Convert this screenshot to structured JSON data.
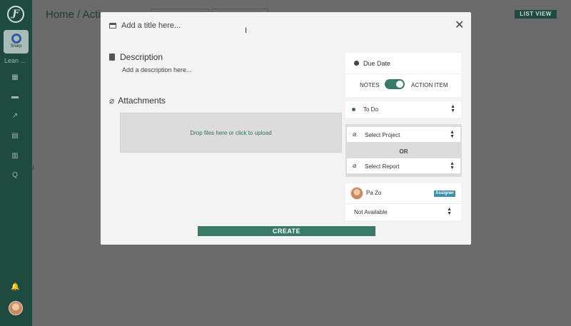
{
  "sidebar": {
    "logo_glyph": "Ƒ",
    "workspace_card_label": "Sharp",
    "workspace_name": "Lean ...",
    "nav_icons": [
      "dashboard-icon",
      "folder-icon",
      "chart-icon",
      "board-icon",
      "book-icon",
      "q-icon"
    ],
    "nav_glyphs": [
      "▦",
      "▬",
      "↗",
      "▤",
      "▥",
      "Q"
    ],
    "bell_glyph": "🔔"
  },
  "header": {
    "title": "Home / Actio",
    "list_view_label": "LIST VIEW"
  },
  "modal": {
    "title_placeholder": "Add a title here...",
    "close_glyph": "✕",
    "cursor_glyph": "I",
    "description_heading": "Description",
    "description_placeholder": "Add a description here...",
    "attachments_heading": "Attachments",
    "attachment_glyph": "⌀",
    "dropzone_text": "Drop files here or click to upload",
    "due_date_label": "Due Date",
    "toggle_left_label": "NOTES",
    "toggle_right_label": "ACTION ITEM",
    "status_value": "To Do",
    "select_project_label": "Select Project",
    "or_label": "OR",
    "select_report_label": "Select Report",
    "assignee_name": "Pa Zo",
    "assignee_badge": "Assigner",
    "availability_value": "Not Available",
    "create_label": "CREATE",
    "caret_up": "▲",
    "caret_down": "▼",
    "clip_glyph": "⌀"
  },
  "colors": {
    "sidebar_bg": "#1f4a3f",
    "accent": "#3a7a68",
    "badge": "#3d8fa8",
    "overlay": "#6b6b6b"
  }
}
